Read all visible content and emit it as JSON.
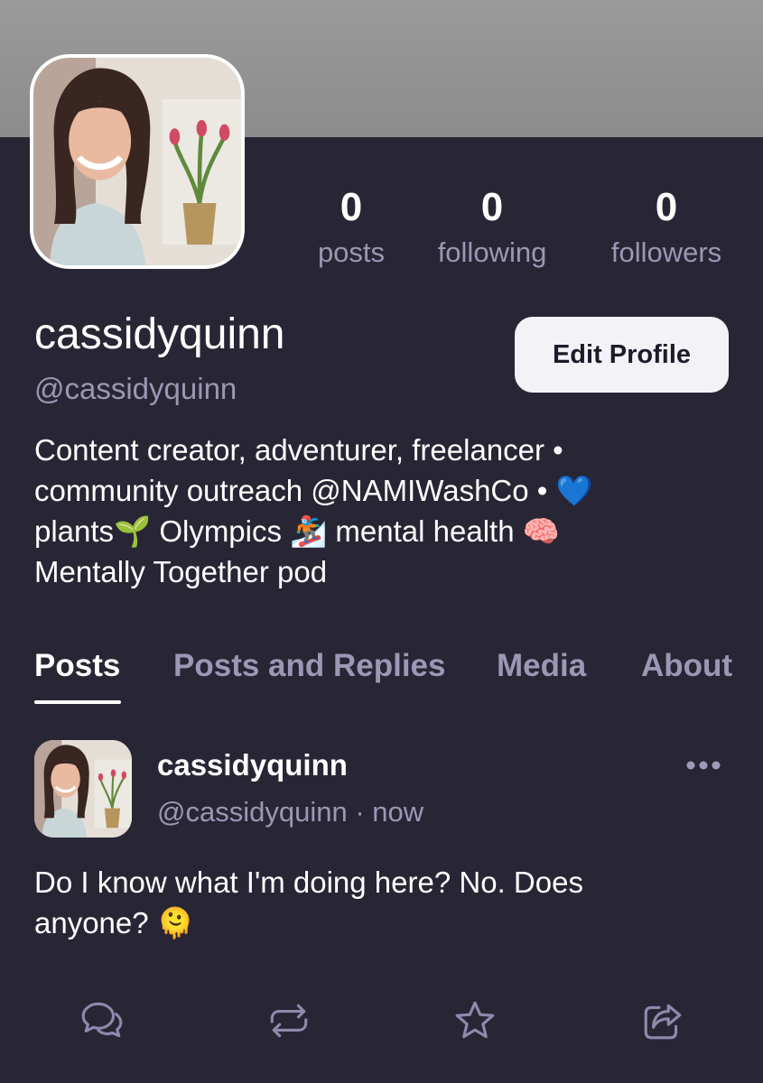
{
  "colors": {
    "background": "#282635",
    "banner": "#929292",
    "muted_text": "#9c97b4",
    "button_bg": "#f3f2f7",
    "icon": "#8f89ad"
  },
  "profile": {
    "display_name": "cassidyquinn",
    "handle": "@cassidyquinn",
    "edit_button_label": "Edit Profile",
    "bio_lines": [
      "Content creator, adventurer, freelancer •",
      "community outreach @NAMIWashCo • 💙",
      "plants🌱 Olympics 🏂 mental health 🧠",
      "Mentally Together pod"
    ]
  },
  "stats": [
    {
      "value": "0",
      "label": "posts"
    },
    {
      "value": "0",
      "label": "following"
    },
    {
      "value": "0",
      "label": "followers"
    }
  ],
  "tabs": [
    {
      "label": "Posts",
      "active": true
    },
    {
      "label": "Posts and Replies",
      "active": false
    },
    {
      "label": "Media",
      "active": false
    },
    {
      "label": "About",
      "active": false
    }
  ],
  "post": {
    "author_name": "cassidyquinn",
    "author_handle": "@cassidyquinn",
    "separator": "·",
    "time": "now",
    "text_lines": [
      "Do I know what I'm doing here? No. Does",
      "anyone? 🫠"
    ],
    "actions": [
      "reply-icon",
      "repost-icon",
      "star-icon",
      "share-icon"
    ],
    "more_icon": "more-horizontal-icon"
  }
}
